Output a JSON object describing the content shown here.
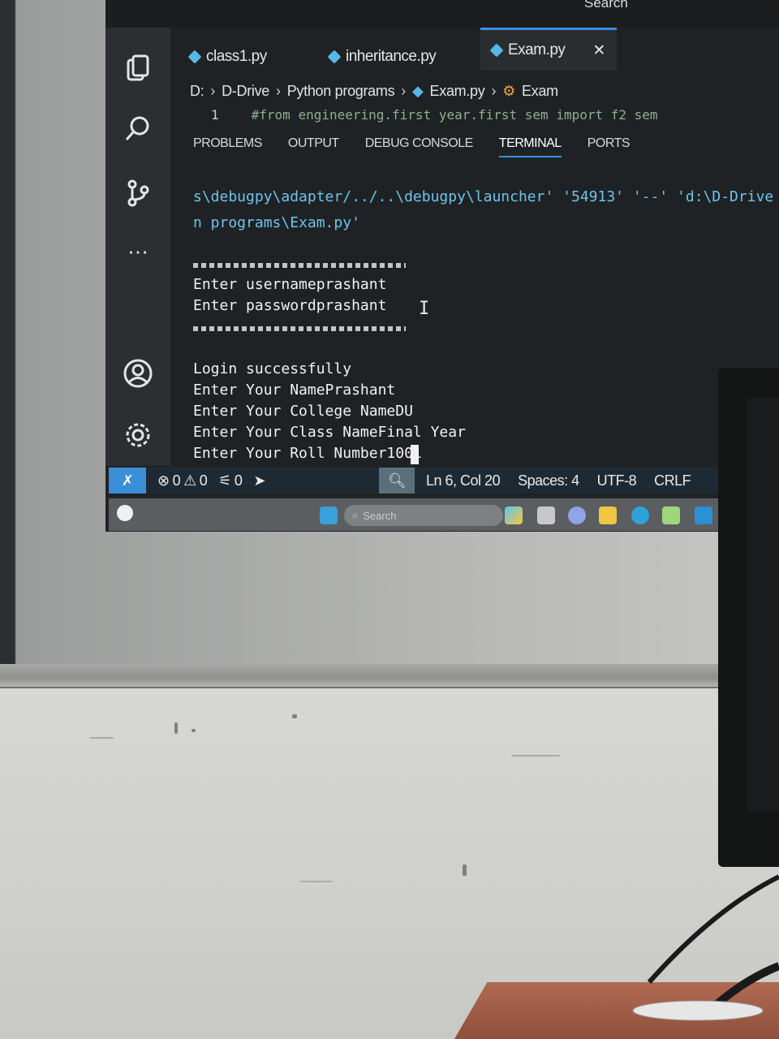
{
  "titlebar": {
    "search_label": "Search"
  },
  "tabs": [
    {
      "label": "class1.py"
    },
    {
      "label": "inheritance.py"
    },
    {
      "label": "Exam.py",
      "close": "✕"
    }
  ],
  "breadcrumb": {
    "drive": "D:",
    "folder1": "D-Drive",
    "folder2": "Python programs",
    "file": "Exam.py",
    "symbol": "Exam"
  },
  "editor": {
    "line_number": "1",
    "line_text": "#from engineering.first year.first sem import f2 sem"
  },
  "panel_tabs": [
    "PROBLEMS",
    "OUTPUT",
    "DEBUG CONSOLE",
    "TERMINAL",
    "PORTS"
  ],
  "terminal": {
    "cmd_line1": "s\\debugpy\\adapter/../..\\debugpy\\launcher' '54913' '--' 'd:\\D-Drive",
    "cmd_line2": "n programs\\Exam.py'",
    "line_username": "Enter usernameprashant",
    "line_password": "Enter passwordprashant",
    "line_login": "Login successfully",
    "line_name": "Enter Your NamePrashant",
    "line_college": "Enter Your College NameDU",
    "line_class": "Enter Your Class NameFinal Year",
    "line_roll": "Enter Your Roll Number1001"
  },
  "statusbar": {
    "remote_icon": "remote-icon",
    "errors": "0",
    "warnings": "0",
    "ports": "0",
    "position": "Ln 6, Col 20",
    "spaces": "Spaces: 4",
    "encoding": "UTF-8",
    "eol": "CRLF"
  },
  "taskbar": {
    "search_placeholder": "Search"
  },
  "colors": {
    "terminal_blue": "#6ec3ee",
    "accent": "#3c8ce6",
    "status_remote": "#3a8fd8"
  }
}
